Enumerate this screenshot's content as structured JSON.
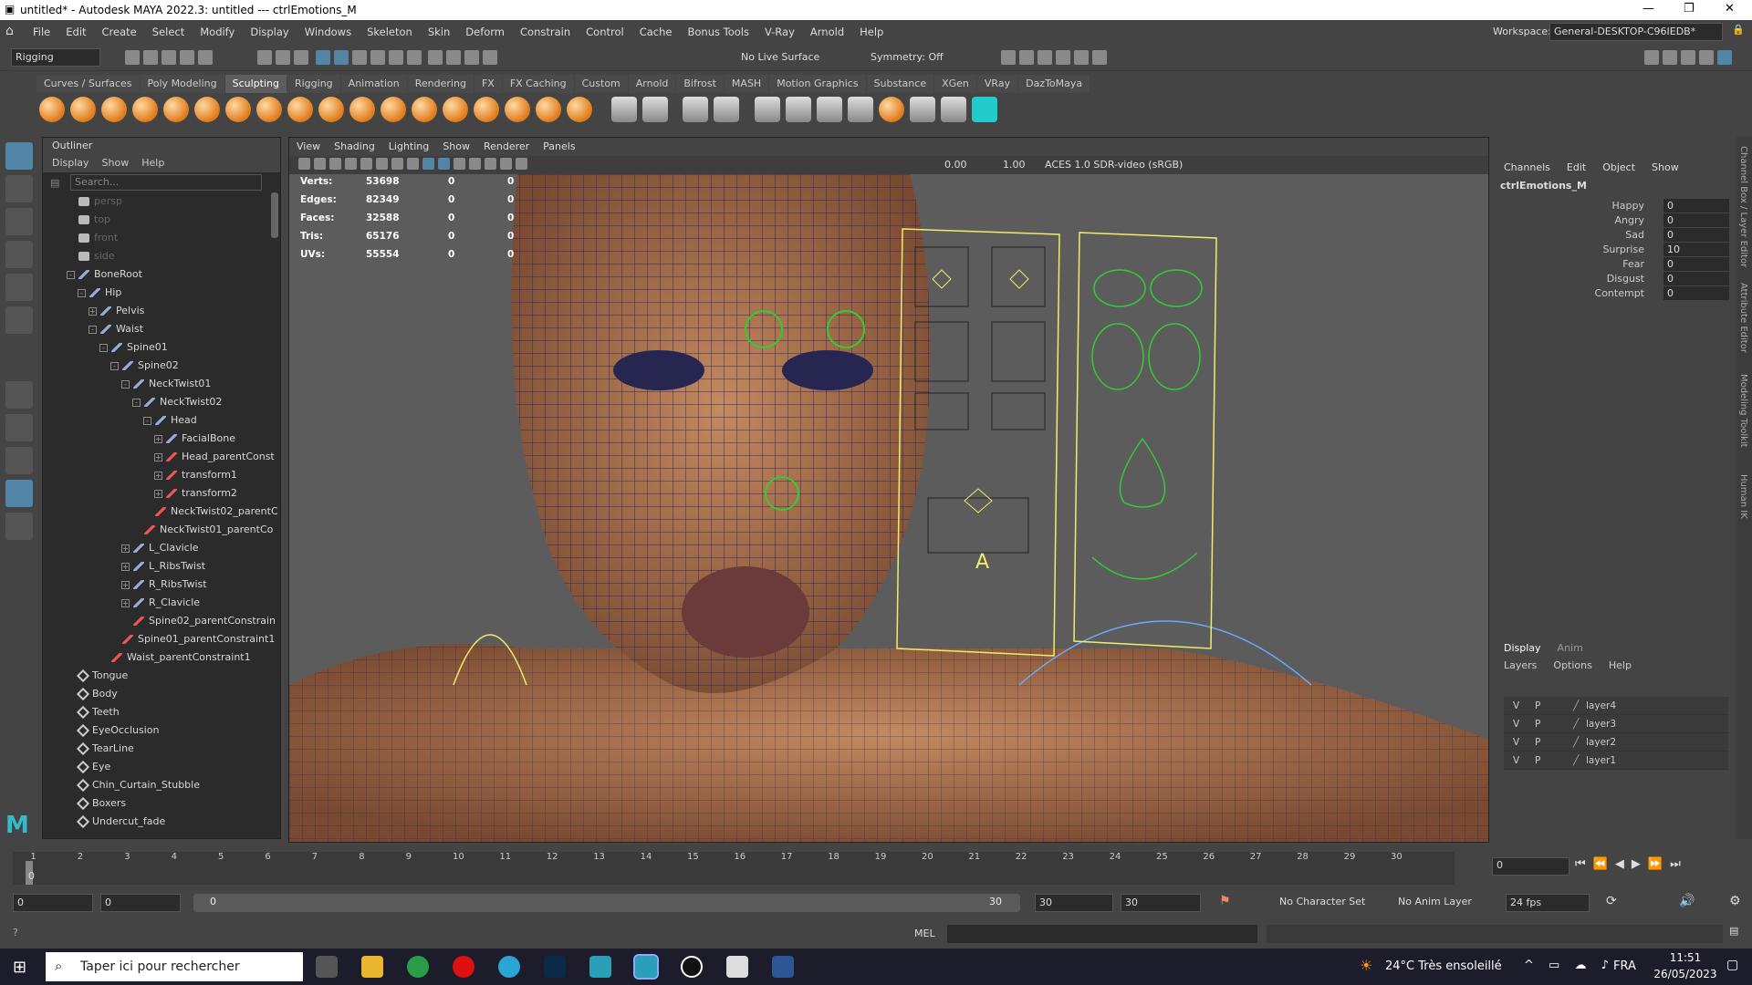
{
  "window": {
    "title": "untitled* - Autodesk MAYA 2022.3: untitled   ---   ctrlEmotions_M"
  },
  "menubar": {
    "items": [
      "File",
      "Edit",
      "Create",
      "Select",
      "Modify",
      "Display",
      "Windows",
      "Skeleton",
      "Skin",
      "Deform",
      "Constrain",
      "Control",
      "Cache",
      "Bonus Tools",
      "V-Ray",
      "Arnold",
      "Help"
    ],
    "workspace_label": "Workspace:",
    "workspace_value": "General-DESKTOP-C96IEDB*"
  },
  "statusline": {
    "menuset": "Rigging",
    "live_surface": "No Live Surface",
    "symmetry": "Symmetry: Off"
  },
  "shelf": {
    "tabs": [
      "Curves / Surfaces",
      "Poly Modeling",
      "Sculpting",
      "Rigging",
      "Animation",
      "Rendering",
      "FX",
      "FX Caching",
      "Custom",
      "Arnold",
      "Bifrost",
      "MASH",
      "Motion Graphics",
      "Substance",
      "XGen",
      "VRay",
      "DazToMaya"
    ],
    "active": "Sculpting"
  },
  "outliner": {
    "title": "Outliner",
    "menu": [
      "Display",
      "Show",
      "Help"
    ],
    "search_placeholder": "Search...",
    "items": [
      {
        "label": "persp",
        "depth": 1,
        "icon": "camera",
        "dim": true
      },
      {
        "label": "top",
        "depth": 1,
        "icon": "camera",
        "dim": true
      },
      {
        "label": "front",
        "depth": 1,
        "icon": "camera",
        "dim": true
      },
      {
        "label": "side",
        "depth": 1,
        "icon": "camera",
        "dim": true
      },
      {
        "label": "BoneRoot",
        "depth": 1,
        "icon": "joint",
        "exp": "-"
      },
      {
        "label": "Hip",
        "depth": 2,
        "icon": "joint",
        "exp": "-"
      },
      {
        "label": "Pelvis",
        "depth": 3,
        "icon": "joint",
        "exp": "+"
      },
      {
        "label": "Waist",
        "depth": 3,
        "icon": "joint",
        "exp": "-"
      },
      {
        "label": "Spine01",
        "depth": 4,
        "icon": "joint",
        "exp": "-"
      },
      {
        "label": "Spine02",
        "depth": 5,
        "icon": "joint",
        "exp": "-"
      },
      {
        "label": "NeckTwist01",
        "depth": 6,
        "icon": "joint",
        "exp": "-"
      },
      {
        "label": "NeckTwist02",
        "depth": 7,
        "icon": "joint",
        "exp": "-"
      },
      {
        "label": "Head",
        "depth": 8,
        "icon": "joint",
        "exp": "-"
      },
      {
        "label": "FacialBone",
        "depth": 9,
        "icon": "joint",
        "exp": "+"
      },
      {
        "label": "Head_parentConst",
        "depth": 9,
        "icon": "constraint",
        "exp": "+"
      },
      {
        "label": "transform1",
        "depth": 9,
        "icon": "constraint",
        "exp": "+"
      },
      {
        "label": "transform2",
        "depth": 9,
        "icon": "constraint",
        "exp": "+"
      },
      {
        "label": "NeckTwist02_parentC",
        "depth": 8,
        "icon": "constraint"
      },
      {
        "label": "NeckTwist01_parentCo",
        "depth": 7,
        "icon": "constraint"
      },
      {
        "label": "L_Clavicle",
        "depth": 6,
        "icon": "joint",
        "exp": "+"
      },
      {
        "label": "L_RibsTwist",
        "depth": 6,
        "icon": "joint",
        "exp": "+"
      },
      {
        "label": "R_RibsTwist",
        "depth": 6,
        "icon": "joint",
        "exp": "+"
      },
      {
        "label": "R_Clavicle",
        "depth": 6,
        "icon": "joint",
        "exp": "+"
      },
      {
        "label": "Spine02_parentConstrain",
        "depth": 6,
        "icon": "constraint"
      },
      {
        "label": "Spine01_parentConstraint1",
        "depth": 5,
        "icon": "constraint"
      },
      {
        "label": "Waist_parentConstraint1",
        "depth": 4,
        "icon": "constraint"
      },
      {
        "label": "Tongue",
        "depth": 1,
        "icon": "mesh"
      },
      {
        "label": "Body",
        "depth": 1,
        "icon": "mesh"
      },
      {
        "label": "Teeth",
        "depth": 1,
        "icon": "mesh"
      },
      {
        "label": "EyeOcclusion",
        "depth": 1,
        "icon": "mesh"
      },
      {
        "label": "TearLine",
        "depth": 1,
        "icon": "mesh"
      },
      {
        "label": "Eye",
        "depth": 1,
        "icon": "mesh"
      },
      {
        "label": "Chin_Curtain_Stubble",
        "depth": 1,
        "icon": "mesh"
      },
      {
        "label": "Boxers",
        "depth": 1,
        "icon": "mesh"
      },
      {
        "label": "Undercut_fade",
        "depth": 1,
        "icon": "mesh"
      }
    ]
  },
  "viewport": {
    "menu": [
      "View",
      "Shading",
      "Lighting",
      "Show",
      "Renderer",
      "Panels"
    ],
    "field_a": "0.00",
    "field_b": "1.00",
    "colorspace": "ACES 1.0 SDR-video (sRGB)",
    "hud": [
      {
        "label": "Verts:",
        "a": "53698",
        "b": "0",
        "c": "0"
      },
      {
        "label": "Edges:",
        "a": "82349",
        "b": "0",
        "c": "0"
      },
      {
        "label": "Faces:",
        "a": "32588",
        "b": "0",
        "c": "0"
      },
      {
        "label": "Tris:",
        "a": "65176",
        "b": "0",
        "c": "0"
      },
      {
        "label": "UVs:",
        "a": "55554",
        "b": "0",
        "c": "0"
      }
    ],
    "letter": "A"
  },
  "channelbox": {
    "menu": [
      "Channels",
      "Edit",
      "Object",
      "Show"
    ],
    "object": "ctrlEmotions_M",
    "channels": [
      {
        "name": "Happy",
        "value": "0"
      },
      {
        "name": "Angry",
        "value": "0"
      },
      {
        "name": "Sad",
        "value": "0"
      },
      {
        "name": "Surprise",
        "value": "10"
      },
      {
        "name": "Fear",
        "value": "0"
      },
      {
        "name": "Disgust",
        "value": "0"
      },
      {
        "name": "Contempt",
        "value": "0"
      }
    ]
  },
  "layers": {
    "tabs": [
      "Display",
      "Anim"
    ],
    "menu": [
      "Layers",
      "Options",
      "Help"
    ],
    "rows": [
      {
        "v": "V",
        "p": "P",
        "name": "layer4"
      },
      {
        "v": "V",
        "p": "P",
        "name": "layer3"
      },
      {
        "v": "V",
        "p": "P",
        "name": "layer2"
      },
      {
        "v": "V",
        "p": "P",
        "name": "layer1"
      }
    ]
  },
  "side_tabs": [
    "Channel Box / Layer Editor",
    "Attribute Editor",
    "Modeling Toolkit",
    "Human IK"
  ],
  "timeline": {
    "ticks": [
      "1",
      "2",
      "3",
      "4",
      "5",
      "6",
      "7",
      "8",
      "9",
      "10",
      "11",
      "12",
      "13",
      "14",
      "15",
      "16",
      "17",
      "18",
      "19",
      "20",
      "21",
      "22",
      "23",
      "24",
      "25",
      "26",
      "27",
      "28",
      "29",
      "30"
    ],
    "current": "0",
    "current_frame_field": "0"
  },
  "range": {
    "start": "0",
    "start2": "0",
    "slider_start": "0",
    "slider_end": "30",
    "end": "30",
    "end2": "30",
    "character_set": "No Character Set",
    "anim_layer": "No Anim Layer",
    "fps": "24 fps"
  },
  "cmdline": {
    "lang": "MEL"
  },
  "taskbar": {
    "search": "Taper ici pour rechercher",
    "weather": "24°C  Très ensoleillé",
    "lang": "FRA",
    "time": "11:51",
    "date": "26/05/2023"
  }
}
